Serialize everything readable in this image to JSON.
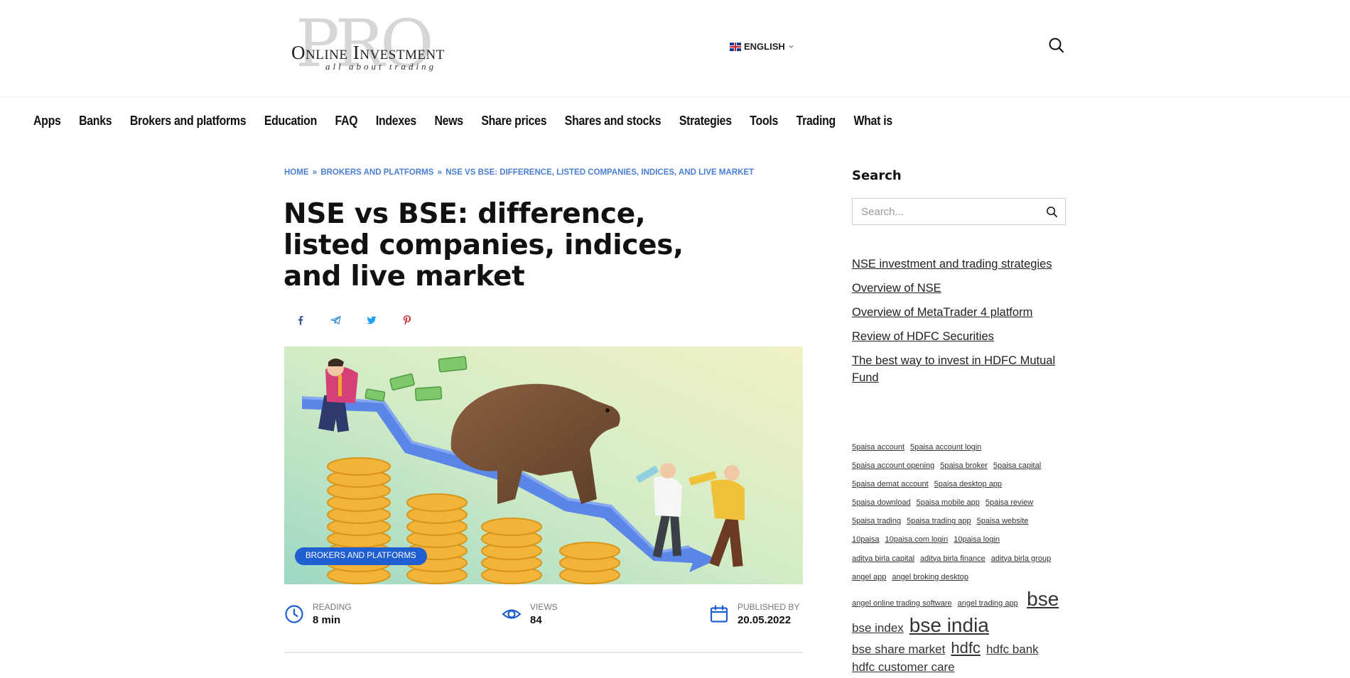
{
  "header": {
    "logo": {
      "bg_text": "PRO",
      "main_text": "Online Investment",
      "tagline": "all about trading"
    },
    "language": "ENGLISH"
  },
  "nav": [
    "Apps",
    "Banks",
    "Brokers and platforms",
    "Education",
    "FAQ",
    "Indexes",
    "News",
    "Share prices",
    "Shares and stocks",
    "Strategies",
    "Tools",
    "Trading",
    "What is"
  ],
  "breadcrumb": {
    "home": "HOME",
    "section": "BROKERS AND PLATFORMS",
    "current": "NSE VS BSE: DIFFERENCE, LISTED COMPANIES, INDICES, AND LIVE MARKET",
    "separator": "»"
  },
  "article": {
    "title": "NSE vs BSE: difference, listed companies, indices, and live market",
    "category_badge": "BROKERS AND PLATFORMS",
    "reading_label": "READING",
    "reading_value": "8 min",
    "views_label": "VIEWS",
    "views_value": "84",
    "published_label": "PUBLISHED BY",
    "published_value": "20.05.2022"
  },
  "sidebar": {
    "search_heading": "Search",
    "search_placeholder": "Search...",
    "links": [
      "NSE investment and trading strategies",
      "Overview of NSE",
      "Overview of MetaTrader 4 platform",
      "Review of HDFC Securities",
      "The best way to invest in HDFC Mutual Fund"
    ],
    "tags_small": [
      "5paisa account",
      "5paisa account login",
      "5paisa account opening",
      "5paisa broker",
      "5paisa capital",
      "5paisa demat account",
      "5paisa desktop app",
      "5paisa download",
      "5paisa mobile app",
      "5paisa review",
      "5paisa trading",
      "5paisa trading app",
      "5paisa website",
      "10paisa",
      "10paisa.com login",
      "10paisa login",
      "aditya birla capital",
      "aditya birla finance",
      "aditya birla group",
      "angel app",
      "angel broking desktop",
      "angel online trading software",
      "angel trading app"
    ],
    "tag_bse": "bse",
    "tag_bse_index": "bse index",
    "tag_bse_india": "bse india",
    "tag_bse_share_market": "bse share market",
    "tag_hdfc": "hdfc",
    "tag_hdfc_bank": "hdfc bank",
    "tag_hdfc_customer_care": "hdfc customer care"
  },
  "colors": {
    "accent": "#1f5fd1",
    "breadcrumb": "#4a7fd4",
    "facebook": "#3b5998",
    "telegram": "#2a8bd2",
    "twitter": "#1da1f2",
    "pinterest": "#cb2027"
  },
  "icons": [
    "search-icon",
    "chevron-down-icon",
    "flag-uk-icon",
    "facebook-icon",
    "telegram-icon",
    "twitter-icon",
    "pinterest-icon",
    "clock-icon",
    "eye-icon",
    "calendar-icon"
  ]
}
